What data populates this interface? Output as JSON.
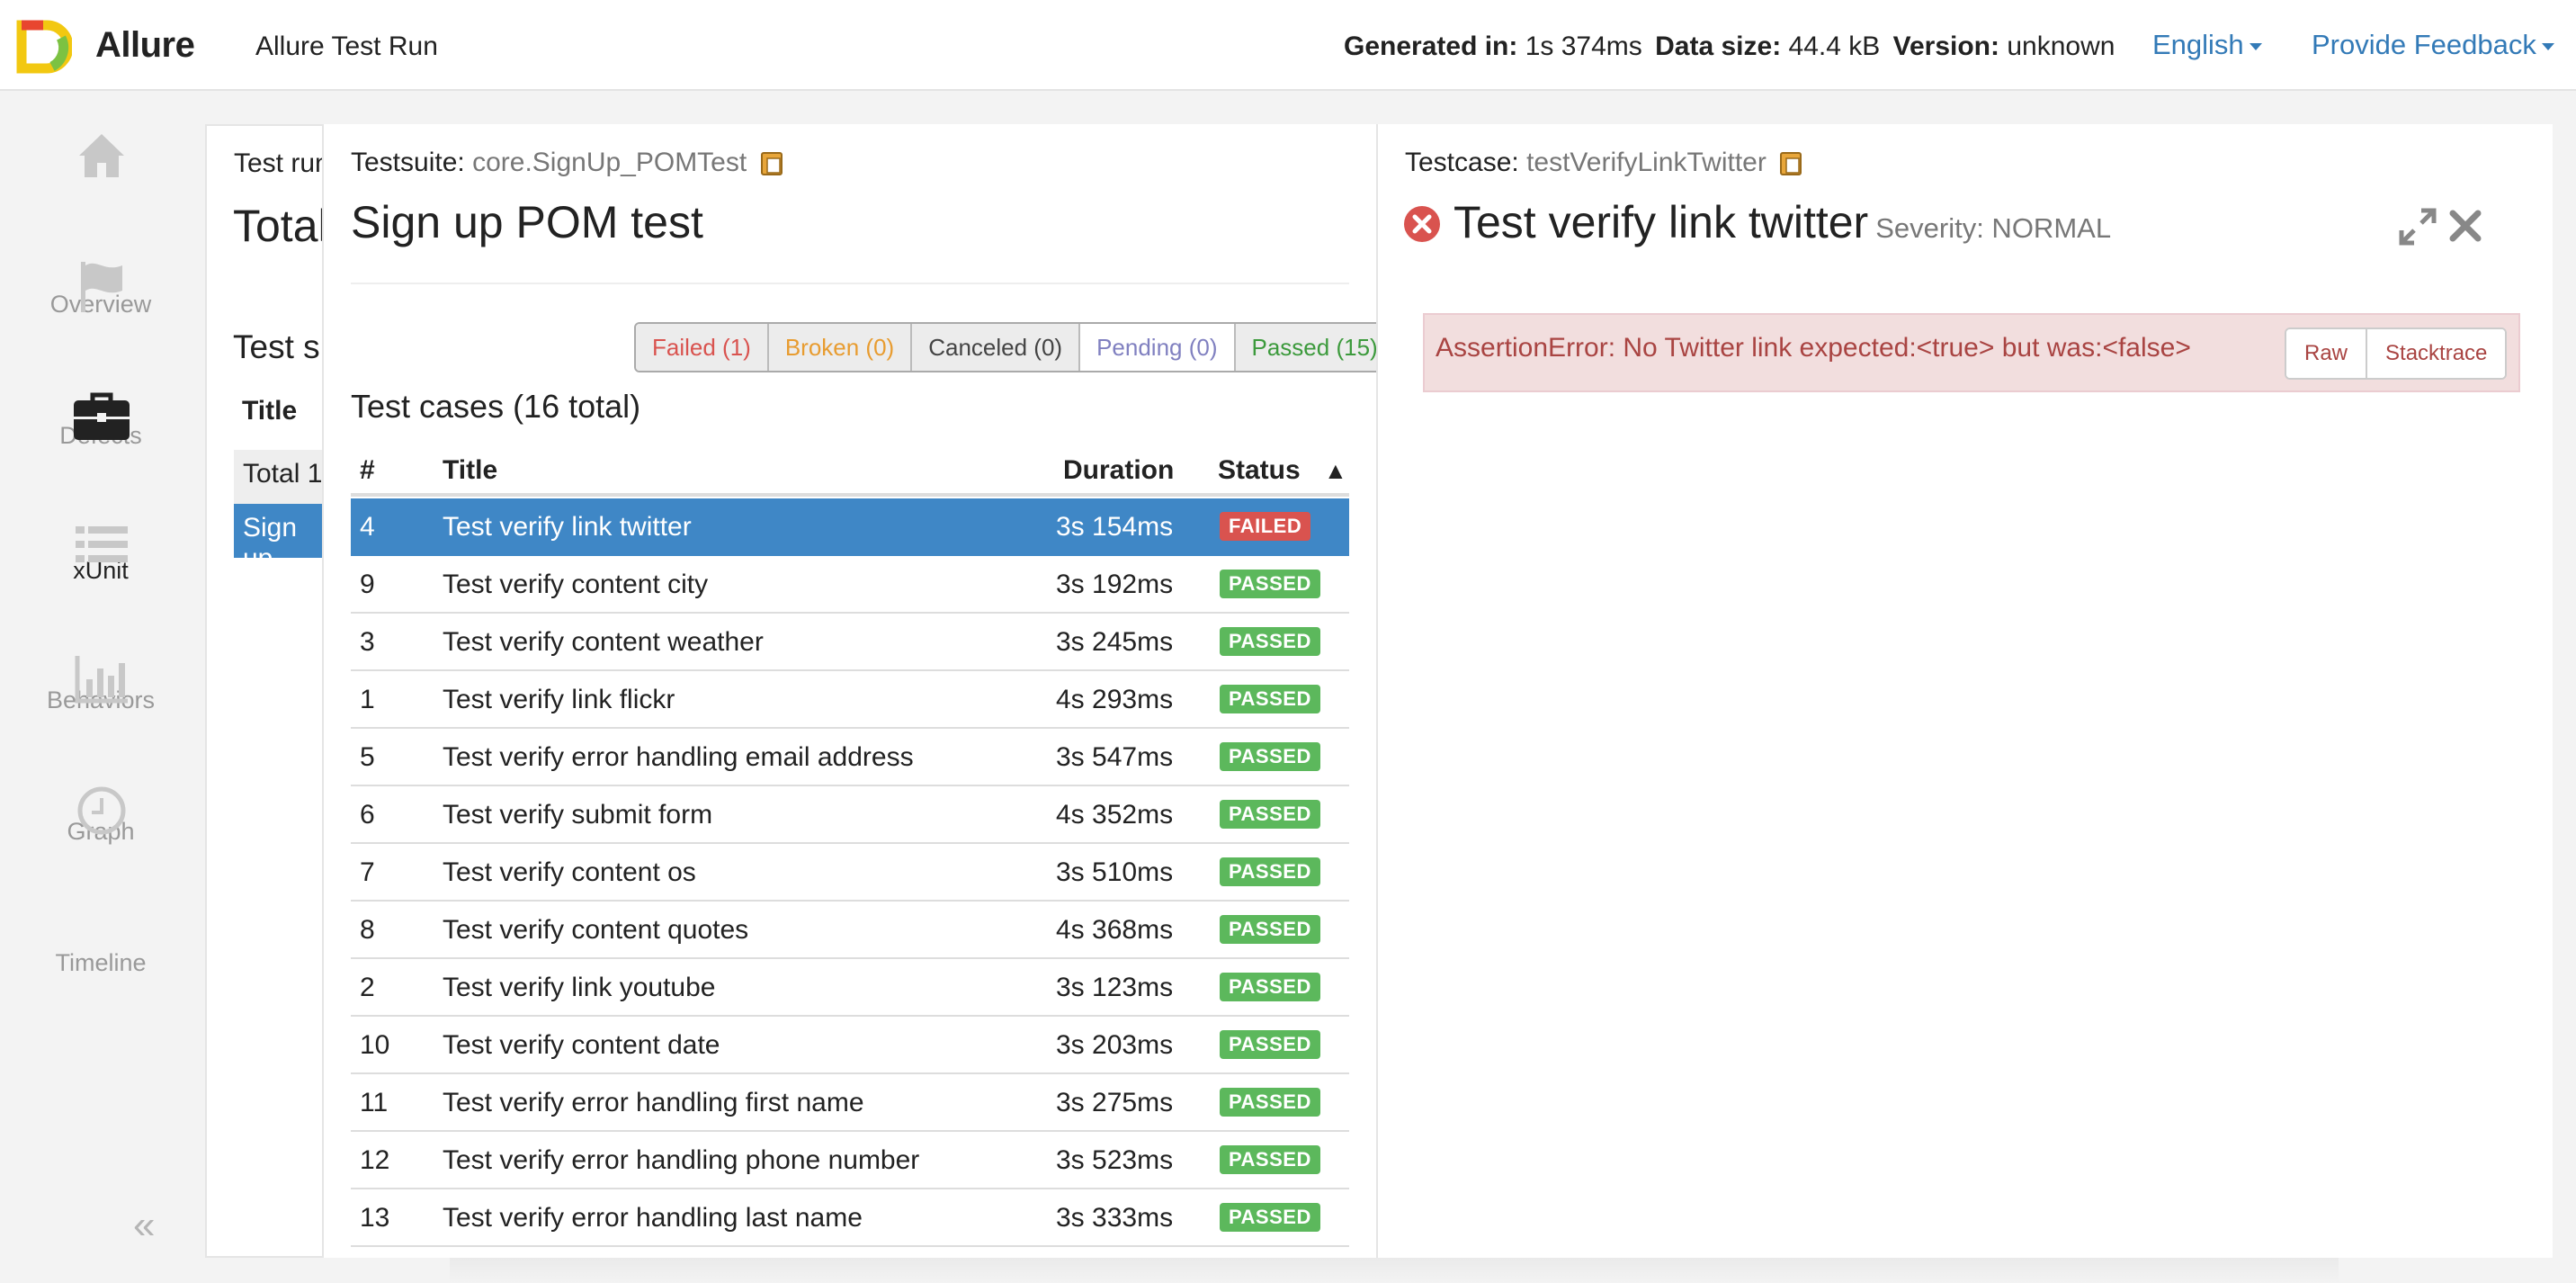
{
  "header": {
    "brand": "Allure",
    "report_title": "Allure Test Run",
    "generated_label": "Generated in:",
    "generated_value": "1s 374ms",
    "data_size_label": "Data size:",
    "data_size_value": "44.4 kB",
    "version_label": "Version:",
    "version_value": "unknown",
    "language": "English",
    "feedback": "Provide Feedback"
  },
  "sidebar": {
    "items": [
      {
        "label": "Overview",
        "icon": "home-icon"
      },
      {
        "label": "Defects",
        "icon": "flag-icon"
      },
      {
        "label": "xUnit",
        "icon": "briefcase-icon",
        "active": true
      },
      {
        "label": "Behaviors",
        "icon": "list-icon"
      },
      {
        "label": "Graph",
        "icon": "bar-chart-icon"
      },
      {
        "label": "Timeline",
        "icon": "clock-icon"
      }
    ],
    "collapse": "«"
  },
  "background": {
    "crumb": "Test run",
    "title": "Total",
    "section": "Test s",
    "col_title": "Title",
    "row_total": "Total 1",
    "row_selected": "Sign up"
  },
  "suite": {
    "crumb_label": "Testsuite:",
    "crumb_value": "core.SignUp_POMTest",
    "title": "Sign up POM test",
    "filters": {
      "failed": "Failed (1)",
      "broken": "Broken (0)",
      "canceled": "Canceled (0)",
      "pending": "Pending (0)",
      "passed": "Passed (15)"
    },
    "cases_heading": "Test cases (16 total)",
    "columns": {
      "num": "#",
      "title": "Title",
      "duration": "Duration",
      "status": "Status",
      "sort": "▲"
    },
    "rows": [
      {
        "num": "4",
        "title": "Test verify link twitter",
        "duration": "3s 154ms",
        "status": "FAILED"
      },
      {
        "num": "9",
        "title": "Test verify content city",
        "duration": "3s 192ms",
        "status": "PASSED"
      },
      {
        "num": "3",
        "title": "Test verify content weather",
        "duration": "3s 245ms",
        "status": "PASSED"
      },
      {
        "num": "1",
        "title": "Test verify link flickr",
        "duration": "4s 293ms",
        "status": "PASSED"
      },
      {
        "num": "5",
        "title": "Test verify error handling email address",
        "duration": "3s 547ms",
        "status": "PASSED"
      },
      {
        "num": "6",
        "title": "Test verify submit form",
        "duration": "4s 352ms",
        "status": "PASSED"
      },
      {
        "num": "7",
        "title": "Test verify content os",
        "duration": "3s 510ms",
        "status": "PASSED"
      },
      {
        "num": "8",
        "title": "Test verify content quotes",
        "duration": "4s 368ms",
        "status": "PASSED"
      },
      {
        "num": "2",
        "title": "Test verify link youtube",
        "duration": "3s 123ms",
        "status": "PASSED"
      },
      {
        "num": "10",
        "title": "Test verify content date",
        "duration": "3s 203ms",
        "status": "PASSED"
      },
      {
        "num": "11",
        "title": "Test verify error handling first name",
        "duration": "3s 275ms",
        "status": "PASSED"
      },
      {
        "num": "12",
        "title": "Test verify error handling phone number",
        "duration": "3s 523ms",
        "status": "PASSED"
      },
      {
        "num": "13",
        "title": "Test verify error handling last name",
        "duration": "3s 333ms",
        "status": "PASSED"
      }
    ]
  },
  "testcase": {
    "crumb_label": "Testcase:",
    "crumb_value": "testVerifyLinkTwitter",
    "title": "Test verify link twitter",
    "severity": "Severity: NORMAL",
    "error_message": "AssertionError: No Twitter link expected:<true> but was:<false>",
    "raw_button": "Raw",
    "stacktrace_button": "Stacktrace"
  },
  "colors": {
    "accent": "#3f87c6",
    "link": "#337ab7",
    "failed": "#d9534f",
    "passed": "#5cb85c",
    "broken": "#e89c30"
  }
}
